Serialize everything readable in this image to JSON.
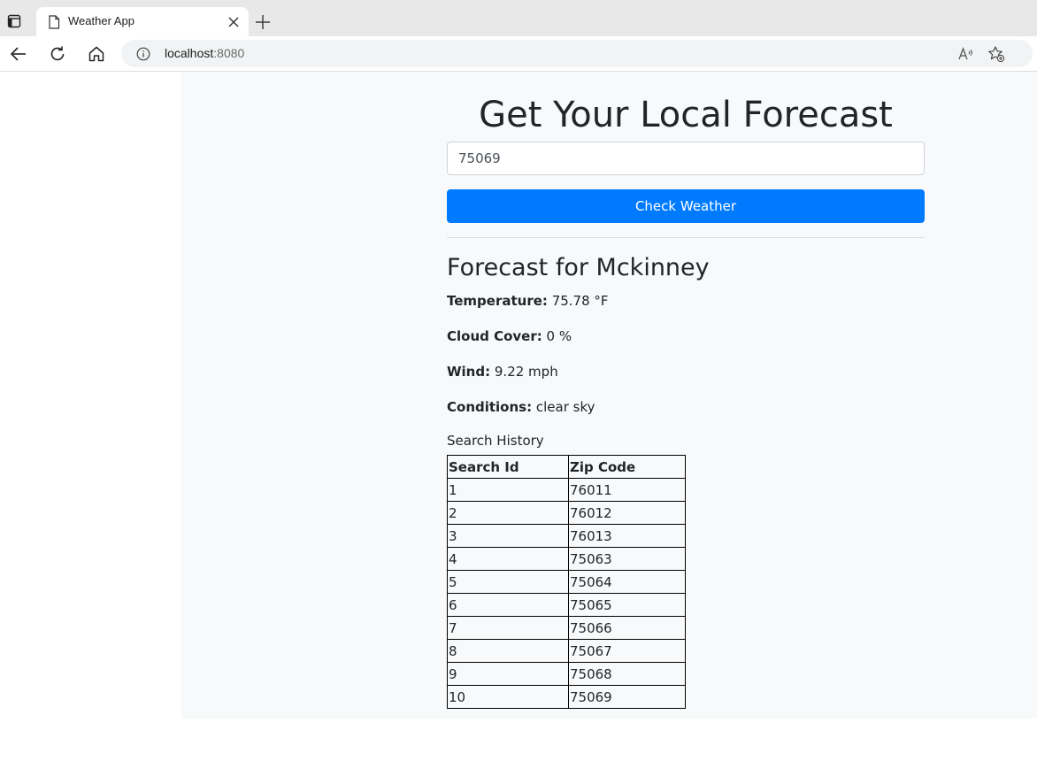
{
  "browser": {
    "tab_title": "Weather App",
    "url_host": "localhost",
    "url_port": ":8080"
  },
  "page": {
    "heading": "Get Your Local Forecast",
    "zip_input_value": "75069",
    "check_button_label": "Check Weather",
    "forecast_heading": "Forecast for Mckinney",
    "temperature_label": "Temperature:",
    "temperature_value": "75.78 °F",
    "cloud_label": "Cloud Cover:",
    "cloud_value": "0 %",
    "wind_label": "Wind:",
    "wind_value": "9.22 mph",
    "conditions_label": "Conditions:",
    "conditions_value": "clear sky",
    "history_label": "Search History",
    "history_columns": [
      "Search Id",
      "Zip Code"
    ],
    "history_rows": [
      [
        "1",
        "76011"
      ],
      [
        "2",
        "76012"
      ],
      [
        "3",
        "76013"
      ],
      [
        "4",
        "75063"
      ],
      [
        "5",
        "75064"
      ],
      [
        "6",
        "75065"
      ],
      [
        "7",
        "75066"
      ],
      [
        "8",
        "75067"
      ],
      [
        "9",
        "75068"
      ],
      [
        "10",
        "75069"
      ]
    ]
  },
  "colors": {
    "primary_button": "#007bff",
    "app_background": "#f8f9fa",
    "text": "#212529"
  },
  "icons": {
    "window_menu": "window-menu-icon",
    "tab_page": "page-icon",
    "tab_close": "close-icon",
    "new_tab": "plus-icon",
    "back": "back-arrow-icon",
    "reload": "reload-icon",
    "home": "home-icon",
    "site_info": "info-icon",
    "read_aloud": "read-aloud-icon",
    "favorites": "add-favorite-icon"
  }
}
